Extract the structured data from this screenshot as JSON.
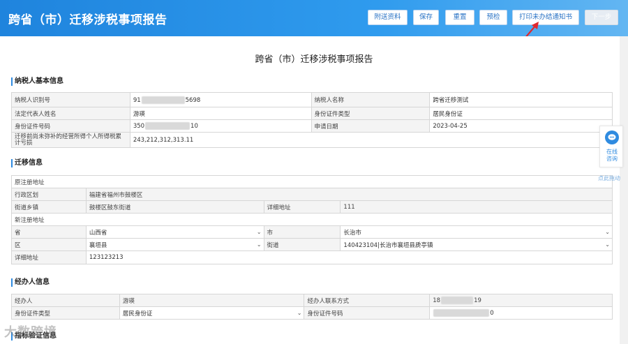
{
  "header": {
    "title": "跨省（市）迁移涉税事项报告",
    "buttons": {
      "attach": "附送资料",
      "save": "保存",
      "reset": "重置",
      "precheck": "预检",
      "print": "打印未办结通知书",
      "next": "下一步"
    }
  },
  "report_title": "跨省（市）迁移涉税事项报告",
  "taxpayer": {
    "section_title": "纳税人基本信息",
    "id_label": "纳税人识别号",
    "id_value_prefix": "91",
    "id_value_suffix": "5698",
    "name_label": "纳税人名称",
    "name_value": "跨省迁移测试",
    "legal_rep_label": "法定代表人姓名",
    "legal_rep_value": "游瑛",
    "cert_type_label": "身份证件类型",
    "cert_type_value": "居民身份证",
    "cert_no_label": "身份证件号码",
    "cert_no_prefix": "350",
    "cert_no_suffix": "10",
    "apply_date_label": "申请日期",
    "apply_date_value": "2023-04-25",
    "deficit_label": "迁移前尚未弥补的经营所得个人所得税累计亏损",
    "deficit_value": "243,212,312,313.11"
  },
  "migration": {
    "section_title": "迁移信息",
    "orig_addr_label": "原注册地址",
    "district_label": "行政区划",
    "district_value": "福建省福州市鼓楼区",
    "street_label": "街道乡镇",
    "street_value": "鼓楼区鼓东街道",
    "detail_label": "详细地址",
    "detail_value": "111",
    "new_addr_label": "新注册地址",
    "province_label": "省",
    "province_value": "山西省",
    "city_label": "市",
    "city_value": "长治市",
    "county_label": "区",
    "county_value": "襄垣县",
    "new_street_label": "街道",
    "new_street_value": "140423104|长治市襄垣县虒亭镇",
    "new_detail_label": "详细地址",
    "new_detail_value": "123123213"
  },
  "agent": {
    "section_title": "经办人信息",
    "name_label": "经办人",
    "name_value": "游瑛",
    "contact_label": "经办人联系方式",
    "contact_prefix": "18",
    "contact_suffix": "19",
    "cert_type_label": "身份证件类型",
    "cert_type_value": "居民身份证",
    "cert_no_label": "身份证件号码",
    "cert_no_suffix": "0"
  },
  "next_section_partial": "指标验证信息",
  "float_chat": {
    "line1": "在线",
    "line2": "咨询",
    "drag": "点此拖动"
  },
  "watermark": "大数跨境",
  "colors": {
    "header_blue": "#1f84dd",
    "accent": "#2f8be0",
    "annotation_red": "#e0282e"
  }
}
